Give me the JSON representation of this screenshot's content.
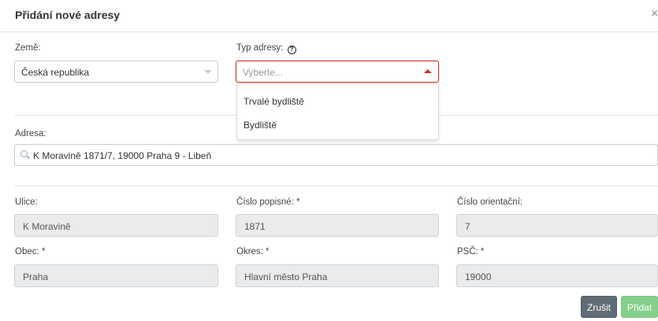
{
  "modal": {
    "title": "Přidání nové adresy",
    "close_glyph": "×"
  },
  "country": {
    "label": "Země:",
    "value": "Česká republika"
  },
  "address_type": {
    "label": "Typ adresy:",
    "help_icon": "question-circle-icon",
    "placeholder": "Vyberte...",
    "options": [
      "Trvalé bydliště",
      "Bydliště"
    ]
  },
  "address": {
    "label": "Adresa:",
    "search_icon": "search-icon",
    "value": "K Moravině 1871/7, 19000 Praha 9 - Libeň"
  },
  "fields": {
    "street": {
      "label": "Ulice:",
      "value": "K Moravině"
    },
    "house_number": {
      "label": "Číslo popisné: *",
      "value": "1871"
    },
    "orientation_number": {
      "label": "Číslo orientační:",
      "value": "7"
    },
    "municipality": {
      "label": "Obec: *",
      "value": "Praha"
    },
    "district": {
      "label": "Okres: *",
      "value": "Hlavní město Praha"
    },
    "postal_code": {
      "label": "PSČ: *",
      "value": "19000"
    }
  },
  "buttons": {
    "cancel": "Zrušit",
    "add": "Přidat"
  },
  "colors": {
    "focus_border": "#c9302c",
    "cancel_button": "#5f6b75",
    "add_button": "#84cf8b",
    "readonly_bg": "#e9ebed"
  }
}
